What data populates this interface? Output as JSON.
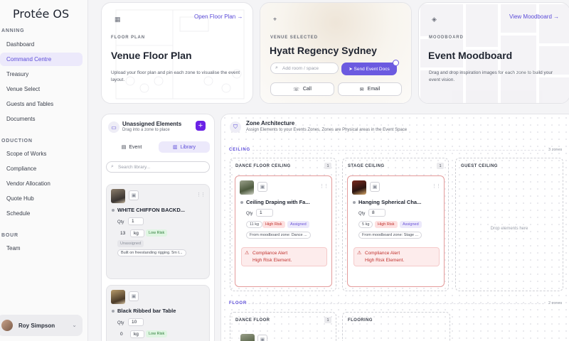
{
  "app": {
    "title": "Protée OS"
  },
  "sidebar": {
    "sections": [
      {
        "label": "ANNING",
        "items": [
          {
            "label": "Dashboard",
            "icon": "grid-icon"
          },
          {
            "label": "Command Centre",
            "icon": "command-icon",
            "active": true
          },
          {
            "label": "Treasury",
            "icon": "wallet-icon"
          },
          {
            "label": "Venue Select",
            "icon": "building-icon"
          },
          {
            "label": "Guests and Tables",
            "icon": "users-icon"
          },
          {
            "label": "Documents",
            "icon": "file-icon"
          }
        ]
      },
      {
        "label": "ODUCTION",
        "items": [
          {
            "label": "Scope of Works",
            "icon": "list-icon"
          },
          {
            "label": "Compliance",
            "icon": "shield-icon"
          },
          {
            "label": "Vendor Allocation",
            "icon": "truck-icon"
          },
          {
            "label": "Quote Hub",
            "icon": "quote-icon"
          },
          {
            "label": "Schedule",
            "icon": "calendar-icon"
          }
        ]
      },
      {
        "label": "BOUR",
        "items": [
          {
            "label": "Team",
            "icon": "team-icon"
          }
        ]
      }
    ],
    "user": {
      "name": "Roy Simpson"
    }
  },
  "top_cards": {
    "floor": {
      "eyebrow": "FLOOR PLAN",
      "title": "Venue Floor Plan",
      "desc": "Upload your floor plan and pin each zone to visualise the event layout.",
      "link": "Open Floor Plan →"
    },
    "venue": {
      "eyebrow": "VENUE SELECTED",
      "title": "Hyatt Regency Sydney",
      "input_placeholder": "Add room / space",
      "send_label": "Send Event Docs",
      "call_label": "Call",
      "email_label": "Email"
    },
    "mood": {
      "eyebrow": "MOODBOARD",
      "title": "Event Moodboard",
      "desc": "Drag and drop inspiration images for each zone to build your event vision.",
      "link": "View Moodboard →"
    }
  },
  "unassigned": {
    "title": "Unassigned Elements",
    "subtitle": "Drag into a zone to place",
    "tabs": {
      "event": "Event",
      "library": "Library"
    },
    "search_placeholder": "Search library...",
    "items": [
      {
        "name": "WHITE CHIFFON BACKD...",
        "qty_label": "Qty",
        "qty": "1",
        "weight": "13",
        "unit": "kg",
        "risk": "Low Risk",
        "status": "Unassigned",
        "note": "Built on freestanding rigging. 5m t..."
      },
      {
        "name": "Black Ribbed bar Table",
        "qty_label": "Qty",
        "qty": "10",
        "weight": "0",
        "unit": "kg",
        "risk": "Low Risk"
      }
    ]
  },
  "zones": {
    "title": "Zone Architecture",
    "subtitle": "Assign Elements to your Events Zones, Zones are Physical areas in the Event Space",
    "ceiling": {
      "label": "CEILING",
      "count": "3 zones",
      "zones": [
        {
          "name": "DANCE FLOOR CEILING",
          "badge": "1",
          "element": {
            "name": "Ceiling Draping with Fa...",
            "qty_label": "Qty",
            "qty": "1",
            "weight": "11 kg",
            "risk": "High Risk",
            "status": "Assigned",
            "source": "From moodboard zone: Dance ...",
            "alert_title": "Compliance Alert",
            "alert_msg": "High Risk Element."
          }
        },
        {
          "name": "STAGE CEILING",
          "badge": "1",
          "element": {
            "name": "Hanging Spherical Cha...",
            "qty_label": "Qty",
            "qty": "8",
            "weight": "5 kg",
            "risk": "High Risk",
            "status": "Assigned",
            "source": "From moodboard zone: Stage ...",
            "alert_title": "Compliance Alert",
            "alert_msg": "High Risk Element."
          }
        },
        {
          "name": "GUEST CEILING",
          "empty": "Drop elements here"
        }
      ]
    },
    "floor": {
      "label": "FLOOR",
      "count": "2 zones",
      "zones": [
        {
          "name": "DANCE FLOOR",
          "badge": "1"
        },
        {
          "name": "FLOORING"
        }
      ]
    }
  },
  "colors": {
    "accent": "#6b5ae0",
    "danger": "#c0332f",
    "success": "#2f7d3a"
  }
}
